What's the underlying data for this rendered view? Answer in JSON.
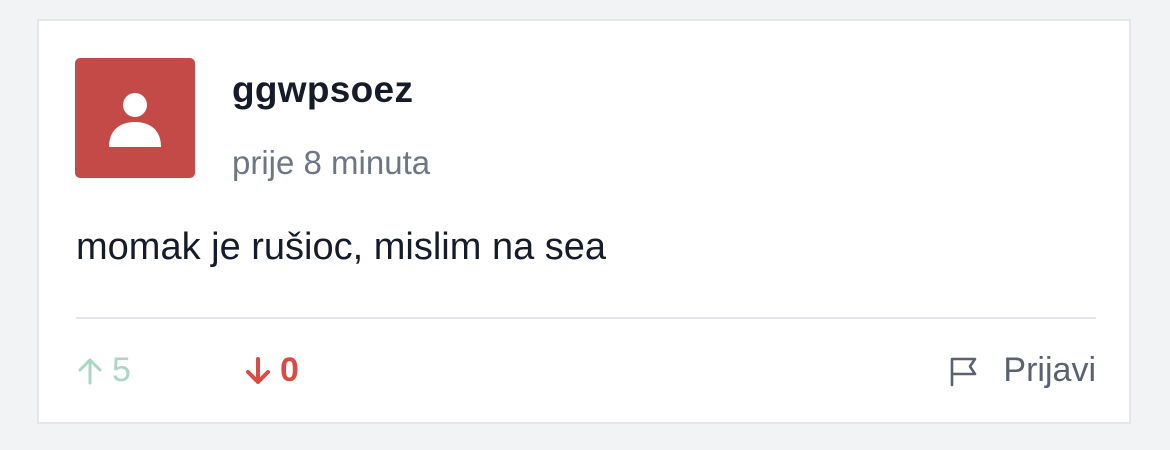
{
  "comment": {
    "author": "ggwpsoez",
    "time": "prije 8 minuta",
    "text": "momak je rušioc, mislim na sea",
    "avatar_color": "#c34a47",
    "avatar_icon": "user-icon"
  },
  "actions": {
    "upvote_icon": "arrow-up-icon",
    "upvote_count": "5",
    "upvote_color": "#a9d6c5",
    "downvote_icon": "arrow-down-icon",
    "downvote_count": "0",
    "downvote_color": "#d94b45",
    "report_icon": "flag-icon",
    "report_label": "Prijavi"
  }
}
